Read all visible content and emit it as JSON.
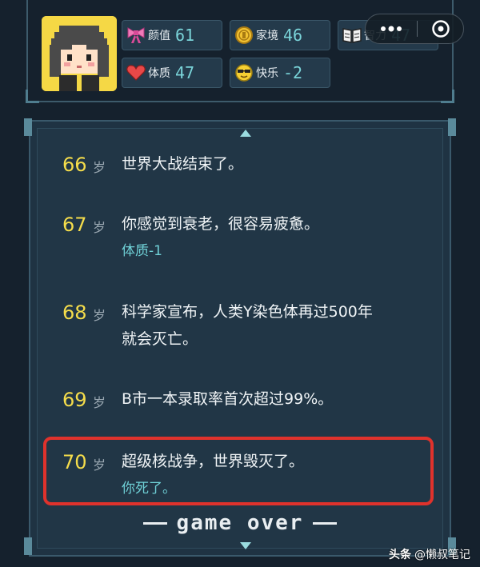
{
  "stats": {
    "appearance": {
      "label": "颜值",
      "value": "61",
      "icon": "bow-icon"
    },
    "family": {
      "label": "家境",
      "value": "46",
      "icon": "coin-icon"
    },
    "intelligence": {
      "label": "智力",
      "value": "47",
      "icon": "book-icon"
    },
    "constitution": {
      "label": "体质",
      "value": "47",
      "icon": "heart-icon"
    },
    "happiness": {
      "label": "快乐",
      "value": "-2",
      "icon": "sunglasses-face-icon"
    }
  },
  "log": [
    {
      "age": "66",
      "unit": "岁",
      "lines": [
        "世界大战结束了。"
      ],
      "sub": ""
    },
    {
      "age": "67",
      "unit": "岁",
      "lines": [
        "你感觉到衰老，很容易疲惫。"
      ],
      "sub": "体质-1"
    },
    {
      "age": "68",
      "unit": "岁",
      "lines": [
        "科学家宣布，人类Y染色体再过500年",
        "就会灭亡。"
      ],
      "sub": ""
    },
    {
      "age": "69",
      "unit": "岁",
      "lines": [
        "B市一本录取率首次超过99%。"
      ],
      "sub": ""
    },
    {
      "age": "70",
      "unit": "岁",
      "lines": [
        "超级核战争，世界毁灭了。"
      ],
      "sub": "你死了。"
    }
  ],
  "gameover_text": "game over",
  "watermark": {
    "brand": "头条",
    "author": "@懒叔笔记"
  },
  "colors": {
    "age": "#f5dd4b",
    "sub": "#6fd0d6",
    "highlight": "#e0322c",
    "panel": "#1f3343"
  }
}
